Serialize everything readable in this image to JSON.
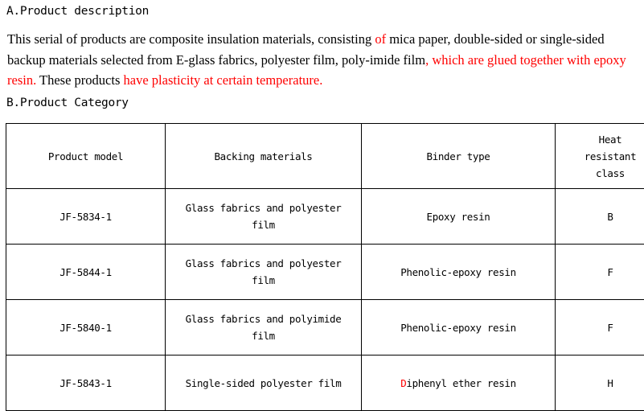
{
  "document": {
    "section_a": {
      "heading": "A.Product description",
      "paragraph_lines": [
        [
          {
            "text": "  This serial of products are composite insulation materials, consisting ",
            "color": "black"
          },
          {
            "text": "of ",
            "color": "red"
          },
          {
            "text": "mica paper,  double-sided or single-sided",
            "color": "black"
          }
        ],
        [
          {
            "text": "backup materials selected from E-glass fabrics, polyester film, poly-imide film",
            "color": "black"
          },
          {
            "text": ", which are glued together with epoxy",
            "color": "red"
          }
        ],
        [
          {
            "text": "resin.",
            "color": "red"
          },
          {
            "text": " These products ",
            "color": "black"
          },
          {
            "text": "have plasticity at certain temperature.",
            "color": "red"
          }
        ]
      ]
    },
    "section_b": {
      "heading": "B.Product Category",
      "table": {
        "columns": [
          {
            "header": "Product model"
          },
          {
            "header": "Backing materials"
          },
          {
            "header_lines": [
              "Heat",
              "resistant",
              "class"
            ]
          },
          {
            "header": "Binder type"
          }
        ],
        "headers": {
          "product_model": "Product model",
          "backing_materials": "Backing materials",
          "binder_type": "Binder type",
          "heat_resistant_class_line1": "Heat",
          "heat_resistant_class_line2": "resistant",
          "heat_resistant_class_line3": "class"
        },
        "rows": [
          {
            "model": "JF-5834-1",
            "backing_line1": "Glass fabrics and polyester",
            "backing_line2": "film",
            "binder_prefix": "",
            "binder_red": "",
            "binder": "Epoxy resin",
            "class": "B"
          },
          {
            "model": "JF-5844-1",
            "backing_line1": "Glass fabrics and polyester",
            "backing_line2": "film",
            "binder_prefix": "",
            "binder_red": "",
            "binder": "Phenolic-epoxy resin",
            "class": "F"
          },
          {
            "model": "JF-5840-1",
            "backing_line1": "Glass fabrics and polyimide",
            "backing_line2": "film",
            "binder_prefix": "",
            "binder_red": "",
            "binder": "Phenolic-epoxy resin",
            "class": "F"
          },
          {
            "model": "JF-5843-1",
            "backing_line1": "Single-sided polyester film",
            "backing_line2": "",
            "binder_red": "D",
            "binder": "iphenyl ether resin",
            "class": "H"
          }
        ]
      }
    }
  },
  "colors": {
    "text": "#000000",
    "highlight_red": "#ff0000",
    "border": "#000000",
    "background": "#ffffff"
  }
}
